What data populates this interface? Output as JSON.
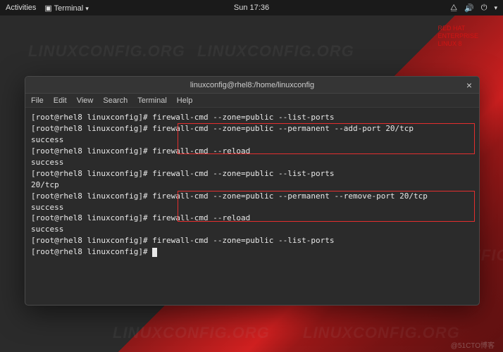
{
  "topbar": {
    "activities": "Activities",
    "app": "Terminal",
    "clock": "Sun 17:36"
  },
  "brand": {
    "l1": "RED HAT",
    "l2": "ENTERPRISE",
    "l3": "LINUX 8"
  },
  "window": {
    "title": "linuxconfig@rhel8:/home/linuxconfig",
    "menus": [
      "File",
      "Edit",
      "View",
      "Search",
      "Terminal",
      "Help"
    ]
  },
  "term": {
    "prompt": "[root@rhel8 linuxconfig]# ",
    "lines": [
      "[root@rhel8 linuxconfig]# firewall-cmd --zone=public --list-ports",
      "",
      "[root@rhel8 linuxconfig]# firewall-cmd --zone=public --permanent --add-port 20/tcp",
      "success",
      "[root@rhel8 linuxconfig]# firewall-cmd --reload",
      "success",
      "[root@rhel8 linuxconfig]# firewall-cmd --zone=public --list-ports",
      "20/tcp",
      "[root@rhel8 linuxconfig]# firewall-cmd --zone=public --permanent --remove-port 20/tcp",
      "success",
      "[root@rhel8 linuxconfig]# firewall-cmd --reload",
      "success",
      "[root@rhel8 linuxconfig]# firewall-cmd --zone=public --list-ports",
      "",
      "[root@rhel8 linuxconfig]# "
    ]
  },
  "watermark": "LINUXCONFIG.ORG",
  "attribution": "@51CTO博客"
}
